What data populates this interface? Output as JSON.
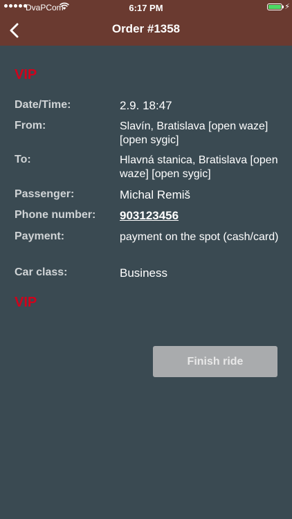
{
  "status": {
    "carrier": "DvaPCom",
    "time": "6:17 PM",
    "battery_level": 1.0,
    "battery_color": "#4cd964"
  },
  "nav": {
    "title": "Order #1358",
    "back_icon": "chevron-left-icon"
  },
  "badge": {
    "vip_top": "VIP",
    "vip_bottom": "VIP",
    "color": "#d0021b"
  },
  "details": {
    "datetime": {
      "label": "Date/Time:",
      "value": "2.9. 18:47"
    },
    "from": {
      "label": "From:",
      "address": "Slavín, Bratislava",
      "waze": "[open waze]",
      "sygic": "[open sygic]"
    },
    "to": {
      "label": "To:",
      "address": "Hlavná stanica, Bratislava",
      "waze": "[open waze]",
      "sygic": "[open sygic]"
    },
    "passenger": {
      "label": "Passenger:",
      "value": "Michal Remiš"
    },
    "phone": {
      "label": "Phone number:",
      "value": "903123456"
    },
    "payment": {
      "label": "Payment:",
      "value": "payment on the spot (cash/card)"
    },
    "car_class": {
      "label": "Car class:",
      "value": "Business"
    }
  },
  "actions": {
    "finish_label": "Finish ride"
  },
  "colors": {
    "header": "#6a3a30",
    "background": "#3a4a52",
    "button": "#a9abad"
  }
}
